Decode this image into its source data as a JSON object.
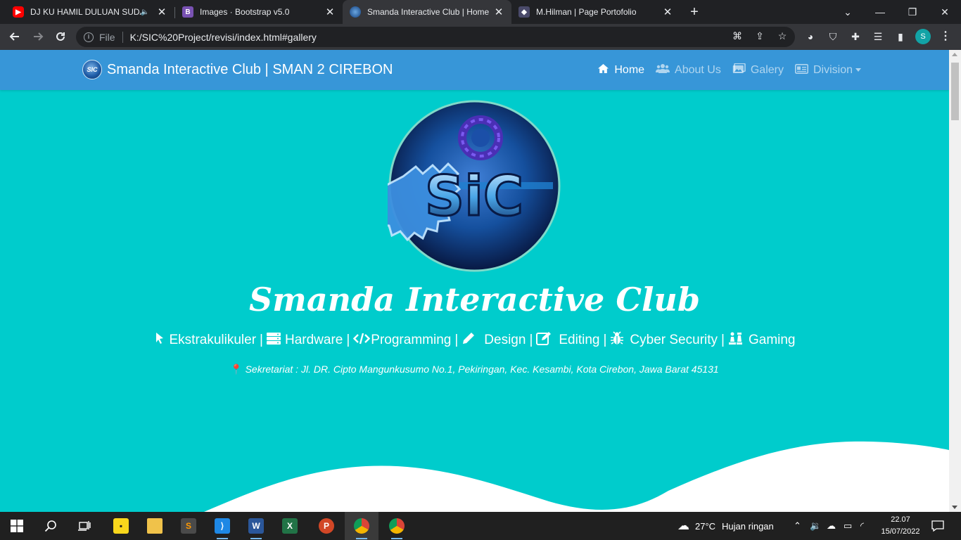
{
  "tabs": [
    {
      "title": "DJ KU HAMIL DULUAN SUDA",
      "favicon": "youtube-icon",
      "color": "#ff0000",
      "audio": true
    },
    {
      "title": "Images · Bootstrap v5.0",
      "favicon": "bootstrap-icon",
      "color": "#7952b3",
      "letter": "B"
    },
    {
      "title": "Smanda Interactive Club | Home",
      "favicon": "sic-logo-icon",
      "active": true
    },
    {
      "title": "M.Hilman | Page Portofolio",
      "favicon": "portfolio-icon"
    }
  ],
  "toolbar": {
    "file_label": "File",
    "url": "K:/SIC%20Project/revisi/index.html#gallery",
    "profile_initial": "S"
  },
  "site": {
    "brand": "Smanda Interactive Club | SMAN 2 CIREBON",
    "nav": [
      {
        "label": "Home",
        "icon": "home-icon",
        "active": true
      },
      {
        "label": "About Us",
        "icon": "users-icon"
      },
      {
        "label": "Galery",
        "icon": "images-icon"
      },
      {
        "label": "Division",
        "icon": "id-card-icon",
        "dropdown": true
      }
    ],
    "hero_title": "Smanda Interactive Club",
    "logo_text": "SIC",
    "divisions": [
      {
        "label": "Ekstrakulikuler",
        "icon": "mouse-pointer-icon"
      },
      {
        "label": "Hardware",
        "icon": "server-icon"
      },
      {
        "label": "Programming",
        "icon": "code-icon"
      },
      {
        "label": "Design",
        "icon": "pencil-icon"
      },
      {
        "label": "Editing",
        "icon": "edit-icon"
      },
      {
        "label": "Cyber Security",
        "icon": "bug-icon"
      },
      {
        "label": "Gaming",
        "icon": "chess-icon"
      }
    ],
    "address": "Sekretariat : Jl. DR. Cipto Mangunkusumo No.1, Pekiringan, Kec. Kesambi, Kota Cirebon, Jawa Barat 45131"
  },
  "taskbar": {
    "weather_temp": "27°C",
    "weather_desc": "Hujan ringan",
    "time": "22.07",
    "date": "15/07/2022"
  },
  "colors": {
    "hero_bg": "#00cccc",
    "navbar_bg": "#3796d8",
    "pin": "#e03b3b"
  }
}
